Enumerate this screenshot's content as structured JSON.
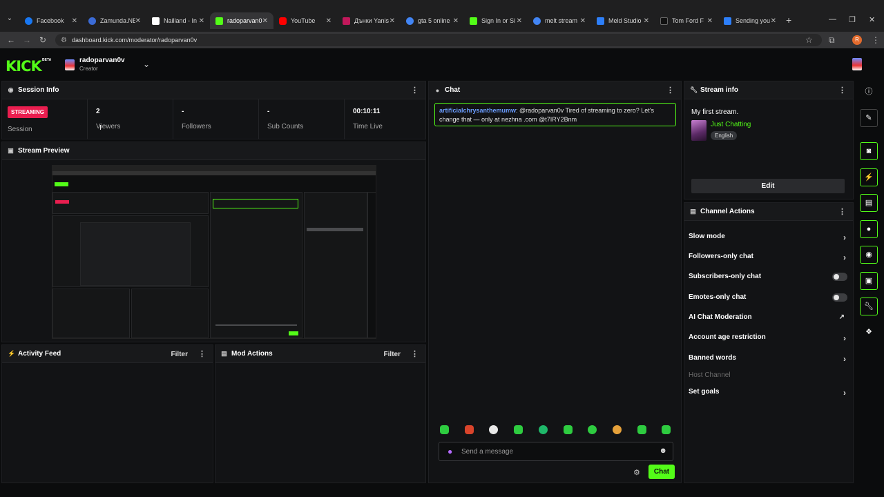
{
  "browser": {
    "tabs": [
      {
        "label": "Facebook",
        "color": "#1877f2"
      },
      {
        "label": "Zamunda.NE",
        "color": "#3b6bd6"
      },
      {
        "label": "Nailland - In",
        "color": "#ffffff"
      },
      {
        "label": "radoparvan0",
        "color": "#53fc18"
      },
      {
        "label": "YouTube",
        "color": "#ff0000"
      },
      {
        "label": "Дънки Yanis",
        "color": "#c2185b"
      },
      {
        "label": "gta 5 online",
        "color": "#4285f4"
      },
      {
        "label": "Sign In or Si",
        "color": "#53fc18"
      },
      {
        "label": "melt stream",
        "color": "#4285f4"
      },
      {
        "label": "Meld Studio",
        "color": "#2d7ff9"
      },
      {
        "label": "Tom Ford F",
        "color": "#111111"
      },
      {
        "label": "Sending you",
        "color": "#2d7ff9"
      }
    ],
    "active_tab": 3,
    "url": "dashboard.kick.com/moderator/radoparvan0v",
    "profile_initial": "R"
  },
  "header": {
    "logo": "KICK",
    "logo_badge": "BETA",
    "channel_name": "radoparvan0v",
    "channel_role": "Creator"
  },
  "session": {
    "title": "Session Info",
    "live_badge": "STREAMING",
    "stats": [
      {
        "value": "",
        "label": "Session"
      },
      {
        "value": "2",
        "label": "Viewers"
      },
      {
        "value": "-",
        "label": "Followers"
      },
      {
        "value": "-",
        "label": "Sub Counts"
      },
      {
        "value": "00:10:11",
        "label": "Time Live"
      }
    ]
  },
  "preview": {
    "title": "Stream Preview"
  },
  "activity": {
    "title": "Activity Feed",
    "filter": "Filter"
  },
  "mod_actions": {
    "title": "Mod Actions",
    "filter": "Filter"
  },
  "chat": {
    "title": "Chat",
    "message": {
      "user": "artificialchrysanthemumw",
      "text": ": @radoparvan0v Tired of streaming to zero? Let's change that — only at nezhna .com @t7IRY2Bnm"
    },
    "placeholder": "Send a message",
    "send_label": "Chat"
  },
  "stream_info": {
    "title": "Stream info",
    "stream_title": "My first stream.",
    "category": "Just Chatting",
    "language": "English",
    "edit_label": "Edit"
  },
  "channel_actions": {
    "title": "Channel Actions",
    "items": [
      {
        "label": "Slow mode",
        "control": "chevron"
      },
      {
        "label": "Followers-only chat",
        "control": "chevron"
      },
      {
        "label": "Subscribers-only chat",
        "control": "toggle"
      },
      {
        "label": "Emotes-only chat",
        "control": "toggle"
      },
      {
        "label": "AI Chat Moderation",
        "control": "external"
      },
      {
        "label": "Account age restriction",
        "control": "chevron"
      },
      {
        "label": "Banned words",
        "control": "chevron"
      },
      {
        "label": "Host Channel",
        "control": "disabled"
      },
      {
        "label": "Set goals",
        "control": "chevron"
      }
    ]
  },
  "rail_icons": [
    "info-icon",
    "pencil-icon",
    "camera-icon",
    "lightning-icon",
    "note-icon",
    "chat-icon",
    "broadcast-icon",
    "layout-icon",
    "wrench-icon",
    "shapes-icon"
  ],
  "colors": {
    "accent": "#53fc18",
    "live": "#e91e4f",
    "panel": "#121315",
    "bg": "#0b0c0d"
  }
}
